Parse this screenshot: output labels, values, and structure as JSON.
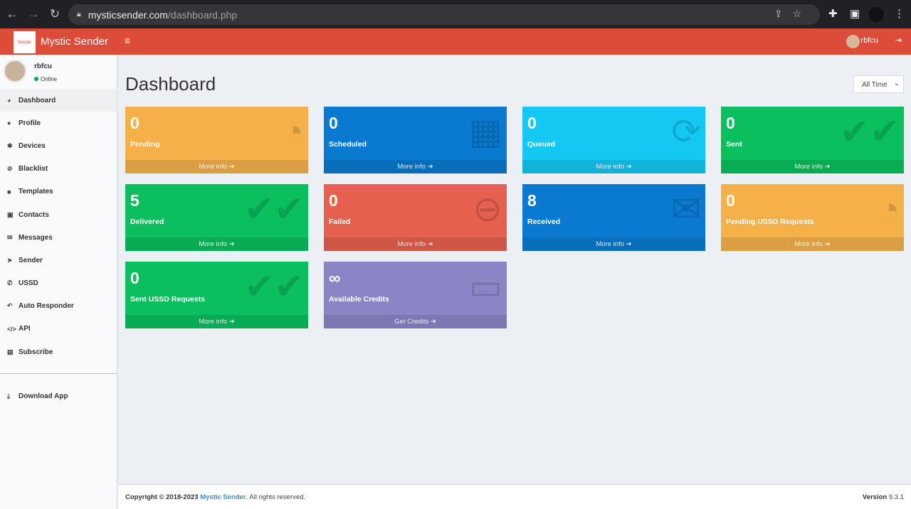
{
  "browser": {
    "host": "mysticsender.com",
    "path": "/dashboard.php"
  },
  "header": {
    "brand": "Mystic Sender",
    "logo_text": "Sender",
    "user": "rbfcu"
  },
  "sidebar": {
    "user": "rbfcu",
    "status": "Online",
    "items": [
      {
        "label": "Dashboard",
        "icon": "◕"
      },
      {
        "label": "Profile",
        "icon": "●"
      },
      {
        "label": "Devices",
        "icon": "✱"
      },
      {
        "label": "Blacklist",
        "icon": "⊘"
      },
      {
        "label": "Templates",
        "icon": "■"
      },
      {
        "label": "Contacts",
        "icon": "▣"
      },
      {
        "label": "Messages",
        "icon": "✉"
      },
      {
        "label": "Sender",
        "icon": "➤"
      },
      {
        "label": "USSD",
        "icon": "✆"
      },
      {
        "label": "Auto Responder",
        "icon": "↶"
      },
      {
        "label": "API",
        "icon": "</>"
      },
      {
        "label": "Subscribe",
        "icon": "▤"
      }
    ],
    "download": {
      "label": "Download App",
      "icon": "⤓"
    }
  },
  "main": {
    "title": "Dashboard",
    "range": "All Time",
    "cards": [
      {
        "value": "0",
        "label": "Pending",
        "link": "More info ➜",
        "icon": "◔",
        "color": "#f5b04a"
      },
      {
        "value": "0",
        "label": "Scheduled",
        "link": "More info ➜",
        "icon": "▦",
        "color": "#0a7ad0"
      },
      {
        "value": "0",
        "label": "Queued",
        "link": "More info ➜",
        "icon": "⟳",
        "color": "#13c8f2"
      },
      {
        "value": "0",
        "label": "Sent",
        "link": "More info ➜",
        "icon": "✔✔",
        "color": "#0bbf5f"
      },
      {
        "value": "5",
        "label": "Delivered",
        "link": "More info ➜",
        "icon": "✔✔",
        "color": "#0bbf5f"
      },
      {
        "value": "0",
        "label": "Failed",
        "link": "More info ➜",
        "icon": "⊖",
        "color": "#e5604f"
      },
      {
        "value": "8",
        "label": "Received",
        "link": "More info ➜",
        "icon": "✉",
        "color": "#0a7ad0"
      },
      {
        "value": "0",
        "label": "Pending USSD Requests",
        "link": "More info ➜",
        "icon": "◔",
        "color": "#f5b04a"
      },
      {
        "value": "0",
        "label": "Sent USSD Requests",
        "link": "More info ➜",
        "icon": "✔✔",
        "color": "#0bbf5f"
      },
      {
        "value": "∞",
        "label": "Available Credits",
        "link": "Get Credits ➜",
        "icon": "▭",
        "color": "#8a86c6"
      }
    ]
  },
  "footer": {
    "copyright": "Copyright © 2018-2023",
    "brand": "Mystic Sender",
    "rights": ". All rights reserved.",
    "version_label": "Version",
    "version": "9.3.1"
  }
}
